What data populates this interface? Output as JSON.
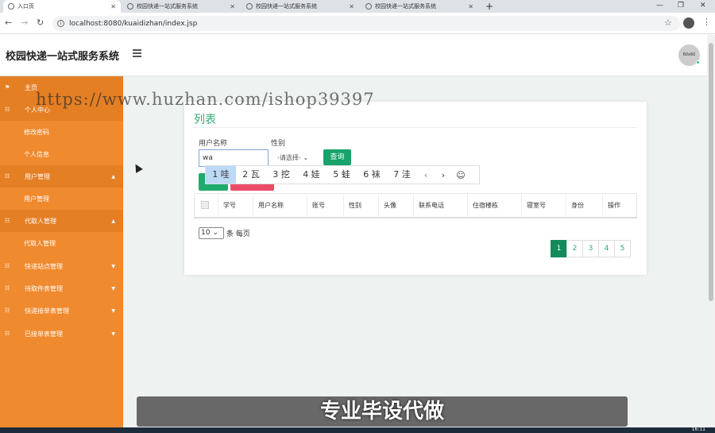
{
  "browser": {
    "tabs": [
      {
        "label": "入口页"
      },
      {
        "label": "校园快递一站式服务系统"
      },
      {
        "label": "校园快递一站式服务系统"
      },
      {
        "label": "校园快递一站式服务系统"
      }
    ],
    "url": "localhost:8080/kuaidizhan/index.jsp"
  },
  "header": {
    "title": "校园快递一站式服务系统",
    "avatar_text": "60x60"
  },
  "sidebar": {
    "items": [
      {
        "label": "主页",
        "icon": "flag-icon"
      },
      {
        "label": "个人中心",
        "icon": "grid-icon"
      },
      {
        "label": "修改密码"
      },
      {
        "label": "个人信息"
      },
      {
        "label": "用户管理",
        "icon": "grid-icon"
      },
      {
        "label": "用户管理"
      },
      {
        "label": "代取人管理",
        "icon": "grid-icon"
      },
      {
        "label": "代取人管理"
      },
      {
        "label": "快递站点管理",
        "icon": "grid-icon"
      },
      {
        "label": "待取件表管理",
        "icon": "grid-icon"
      },
      {
        "label": "快递接单表管理",
        "icon": "grid-icon"
      },
      {
        "label": "已接单表管理",
        "icon": "grid-icon"
      }
    ]
  },
  "main": {
    "card_title": "列表",
    "search": {
      "username_label": "用户名称",
      "username_value": "wa",
      "gender_label": "性别",
      "gender_value": "-请选择-",
      "query_label": "查询"
    },
    "ime_candidates": [
      "1 哇",
      "2 瓦",
      "3 挖",
      "4 娃",
      "5 蛙",
      "6 袜",
      "7 洼"
    ],
    "table_headers": [
      "学号",
      "用户名称",
      "账号",
      "性别",
      "头像",
      "联系电话",
      "住宿楼栋",
      "寝室号",
      "身份",
      "操作"
    ],
    "page_size": "10",
    "page_size_suffix": "条 每页",
    "pages": [
      "1",
      "2",
      "3",
      "4",
      "5"
    ]
  },
  "watermark": "https://www.huzhan.com/ishop39397",
  "promo": "专业毕设代做",
  "taskbar": {
    "clock": "16:11"
  },
  "colors": {
    "sidebar": "#f08a2e",
    "accent": "#2dae72",
    "primary_btn": "#17a36b",
    "danger_btn": "#ea4c68"
  }
}
